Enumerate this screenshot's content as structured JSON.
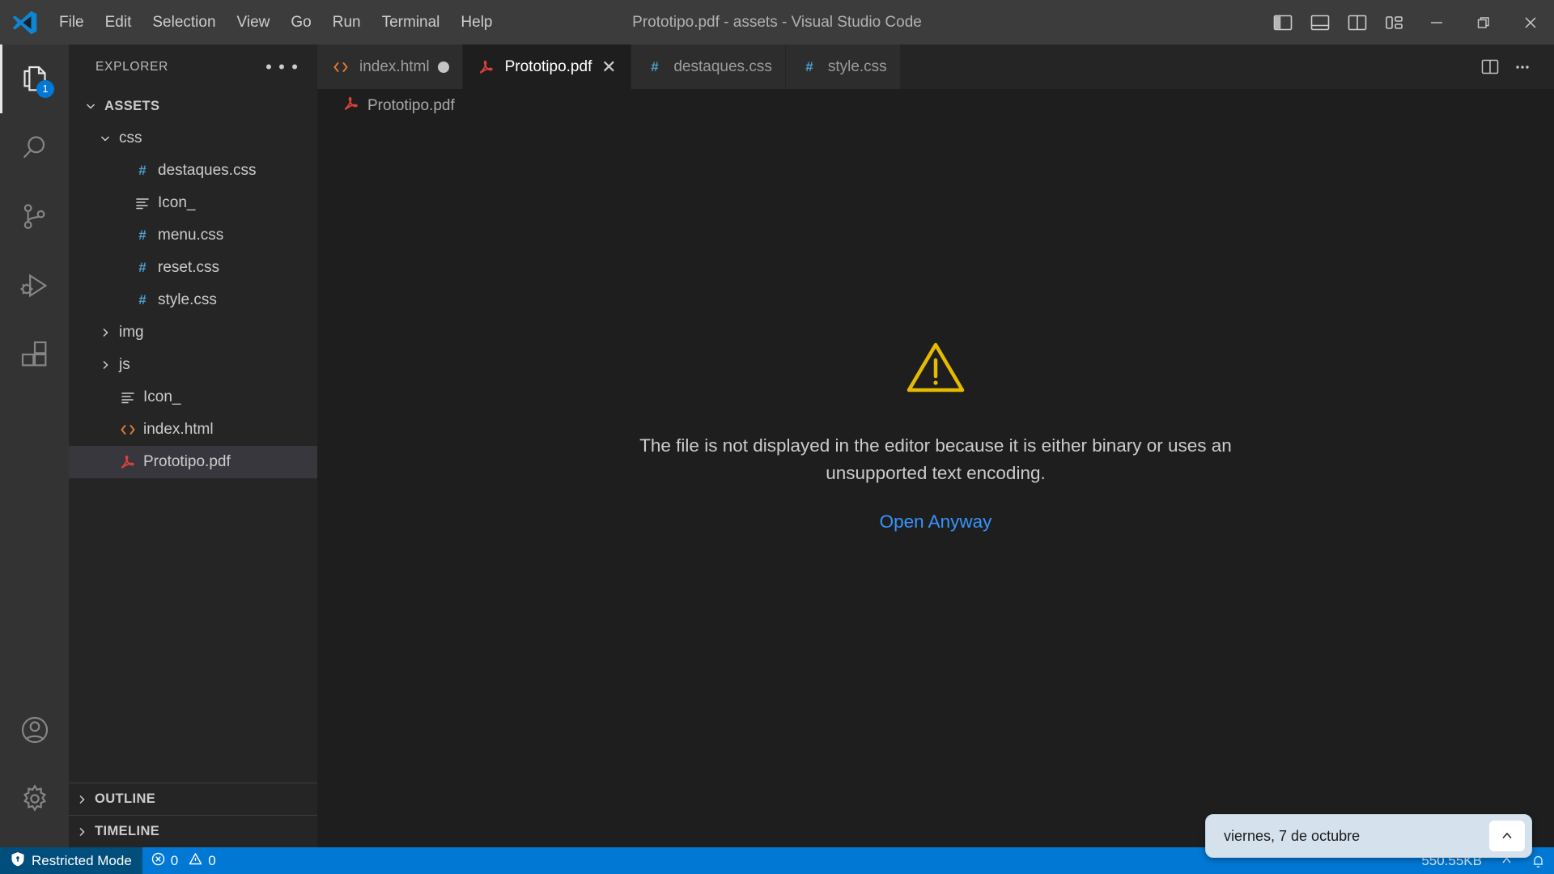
{
  "titlebar": {
    "logo_icon": "vscode-logo-icon",
    "title": "Prototipo.pdf - assets - Visual Studio Code",
    "menus": [
      {
        "label": "File"
      },
      {
        "label": "Edit"
      },
      {
        "label": "Selection"
      },
      {
        "label": "View"
      },
      {
        "label": "Go"
      },
      {
        "label": "Run"
      },
      {
        "label": "Terminal"
      },
      {
        "label": "Help"
      }
    ],
    "layout_buttons": [
      {
        "name": "toggle-primary-sidebar-icon",
        "tooltip": "Toggle Primary Side Bar"
      },
      {
        "name": "toggle-panel-icon",
        "tooltip": "Toggle Panel"
      },
      {
        "name": "toggle-secondary-sidebar-icon",
        "tooltip": "Toggle Secondary Side Bar"
      },
      {
        "name": "customize-layout-icon",
        "tooltip": "Customize Layout"
      }
    ],
    "window_buttons": [
      {
        "name": "minimize-button",
        "glyph": "─"
      },
      {
        "name": "maximize-button",
        "glyph": "❐"
      },
      {
        "name": "close-button",
        "glyph": "✕"
      }
    ]
  },
  "activitybar": {
    "items": [
      {
        "name": "explorer",
        "icon": "files-icon",
        "badge": "1",
        "active": true
      },
      {
        "name": "search",
        "icon": "search-icon",
        "badge": "",
        "active": false
      },
      {
        "name": "source-control",
        "icon": "source-control-icon",
        "badge": "",
        "active": false
      },
      {
        "name": "run-and-debug",
        "icon": "run-debug-icon",
        "badge": "",
        "active": false
      },
      {
        "name": "extensions",
        "icon": "extensions-icon",
        "badge": "",
        "active": false
      }
    ],
    "bottom_items": [
      {
        "name": "accounts",
        "icon": "account-icon"
      },
      {
        "name": "manage",
        "icon": "gear-icon"
      }
    ]
  },
  "sidebar": {
    "title": "EXPLORER",
    "more_actions": "• • •",
    "tree": [
      {
        "label": "ASSETS",
        "icon": "none",
        "twisty": "chevron-down",
        "indent": 0,
        "kind": "root",
        "selected": false
      },
      {
        "label": "css",
        "icon": "none",
        "twisty": "chevron-down",
        "indent": 1,
        "kind": "folder",
        "selected": false
      },
      {
        "label": "destaques.css",
        "icon": "css-icon",
        "twisty": "",
        "indent": 2,
        "kind": "file",
        "selected": false
      },
      {
        "label": "Icon_",
        "icon": "text-icon",
        "twisty": "",
        "indent": 2,
        "kind": "file",
        "selected": false
      },
      {
        "label": "menu.css",
        "icon": "css-icon",
        "twisty": "",
        "indent": 2,
        "kind": "file",
        "selected": false
      },
      {
        "label": "reset.css",
        "icon": "css-icon",
        "twisty": "",
        "indent": 2,
        "kind": "file",
        "selected": false
      },
      {
        "label": "style.css",
        "icon": "css-icon",
        "twisty": "",
        "indent": 2,
        "kind": "file",
        "selected": false
      },
      {
        "label": "img",
        "icon": "none",
        "twisty": "chevron-right",
        "indent": 1,
        "kind": "folder",
        "selected": false
      },
      {
        "label": "js",
        "icon": "none",
        "twisty": "chevron-right",
        "indent": 1,
        "kind": "folder",
        "selected": false
      },
      {
        "label": "Icon_",
        "icon": "text-icon",
        "twisty": "",
        "indent": 1,
        "kind": "file",
        "selected": false
      },
      {
        "label": "index.html",
        "icon": "html-icon",
        "twisty": "",
        "indent": 1,
        "kind": "file",
        "selected": false
      },
      {
        "label": "Prototipo.pdf",
        "icon": "pdf-icon",
        "twisty": "",
        "indent": 1,
        "kind": "file",
        "selected": true
      }
    ],
    "sections": [
      {
        "label": "OUTLINE",
        "twisty": "chevron-right"
      },
      {
        "label": "TIMELINE",
        "twisty": "chevron-right"
      }
    ]
  },
  "editor": {
    "tabs": [
      {
        "label": "index.html",
        "icon": "html-icon",
        "active": false,
        "dirty": true,
        "closable": false
      },
      {
        "label": "Prototipo.pdf",
        "icon": "pdf-icon",
        "active": true,
        "dirty": false,
        "closable": true
      },
      {
        "label": "destaques.css",
        "icon": "css-icon",
        "active": false,
        "dirty": false,
        "closable": false
      },
      {
        "label": "style.css",
        "icon": "css-icon",
        "active": false,
        "dirty": false,
        "closable": false
      }
    ],
    "tab_close_glyph": "✕",
    "actions": [
      {
        "name": "split-editor-right-button",
        "icon": "split-editor-icon"
      },
      {
        "name": "more-editor-actions-button",
        "icon": "ellipsis-icon"
      }
    ],
    "breadcrumb": {
      "icon": "pdf-icon",
      "label": "Prototipo.pdf"
    },
    "placeholder": {
      "icon": "warning-triangle-icon",
      "message": "The file is not displayed in the editor because it is either binary or uses an unsupported text encoding.",
      "action_label": "Open Anyway",
      "action_color": "#3794ff",
      "icon_color": "#e5bb00"
    }
  },
  "statusbar": {
    "background": "#0078d4",
    "restricted": {
      "icon": "shield-icon",
      "label": "Restricted Mode",
      "background": "#004e7c"
    },
    "problems": {
      "errors_icon": "error-icon",
      "errors": "0",
      "warnings_icon": "warning-icon",
      "warnings": "0"
    },
    "right_obscured": {
      "size_label": "550.55KB",
      "bell_icon": "bell-icon",
      "caret_icon": "caret-icon"
    }
  },
  "os_tooltip": {
    "text": "viernes, 7 de octubre",
    "button_icon": "chevron-up-icon",
    "button_glyph": "⌃"
  }
}
